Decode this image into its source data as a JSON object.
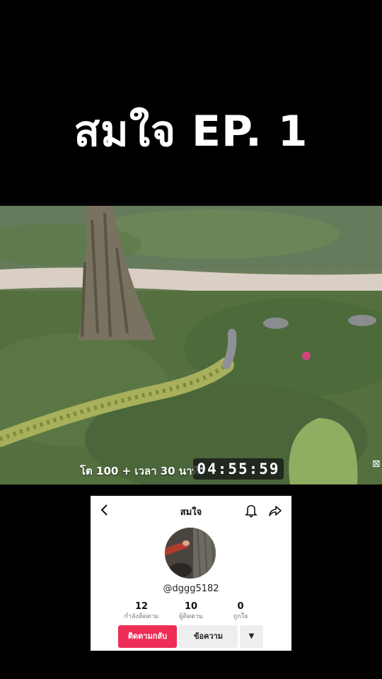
{
  "overlay_title": "สมใจ EP. 1",
  "video": {
    "timer_label": "โต 100 + เวลา 30 นาที",
    "timer": "04:55:59"
  },
  "profile": {
    "title": "สมใจ",
    "handle": "@dggg5182",
    "stats": [
      {
        "value": "12",
        "label": "กำลังติดตาม"
      },
      {
        "value": "10",
        "label": "ผู้ติดตาม"
      },
      {
        "value": "0",
        "label": "ถูกใจ"
      }
    ],
    "follow_back_label": "ติดตามกลับ",
    "message_label": "ข้อความ",
    "more_label": "▼"
  }
}
